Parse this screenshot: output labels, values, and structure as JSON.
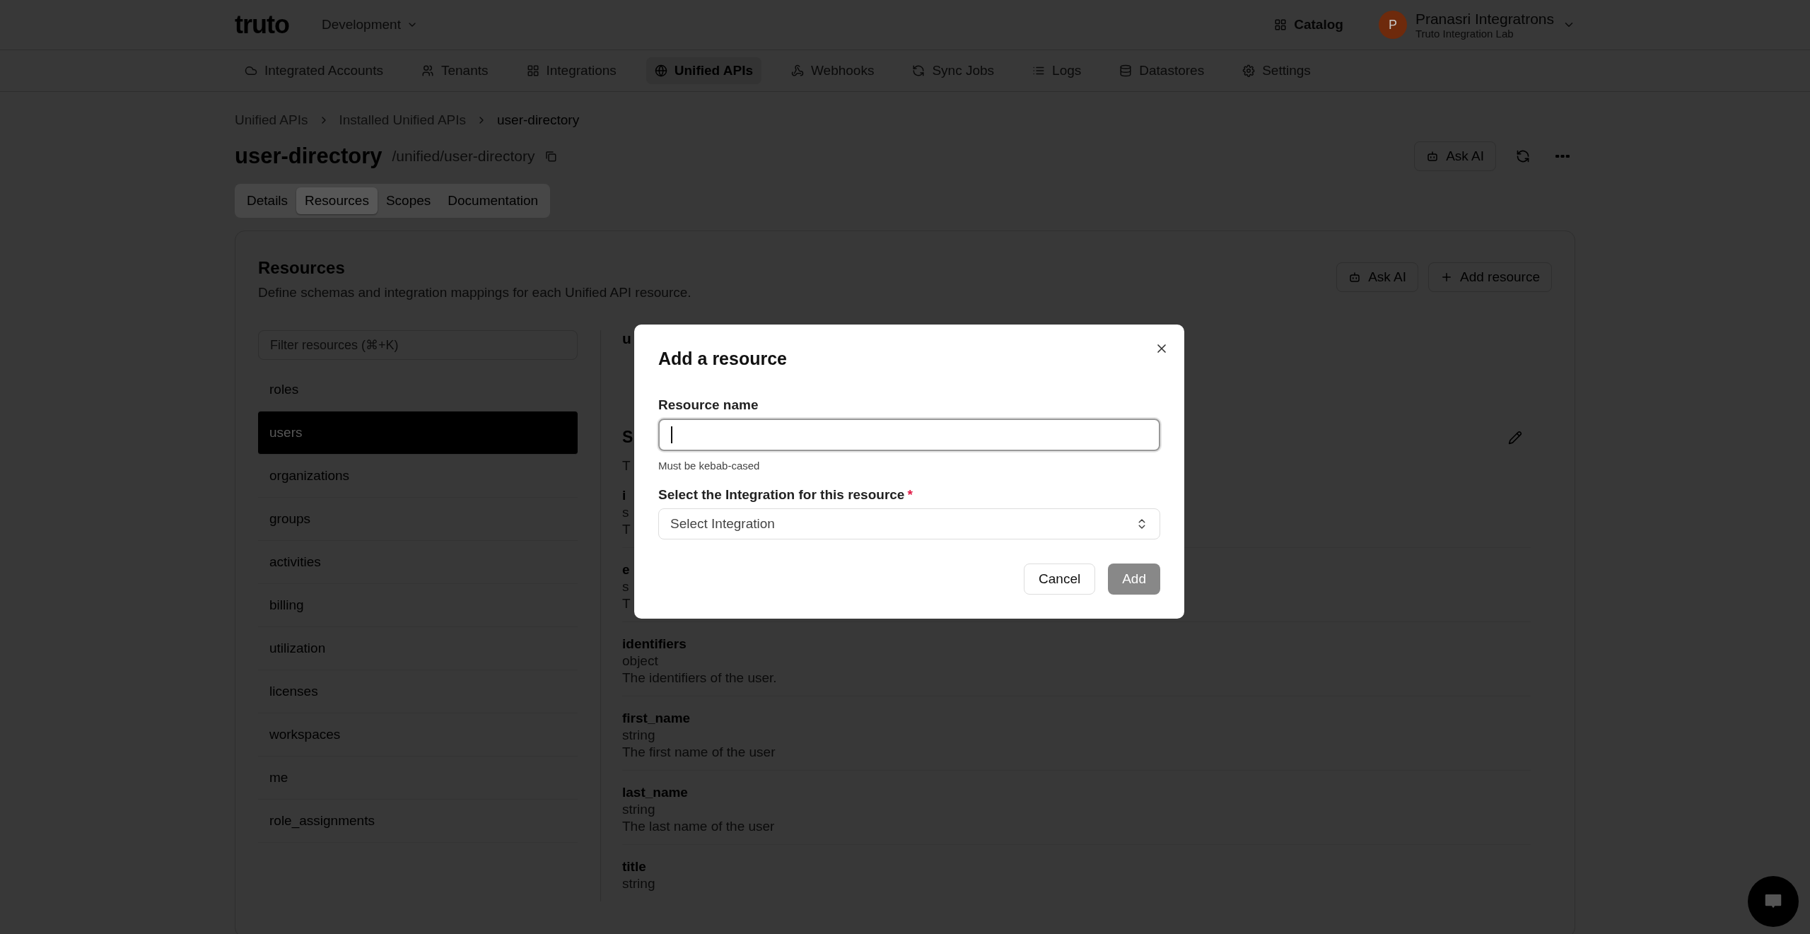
{
  "top_bar": {
    "logo": "truto",
    "environment": "Development",
    "catalog": "Catalog",
    "user": {
      "initial": "P",
      "name": "Pranasri Integratrons",
      "org": "Truto Integration Lab"
    }
  },
  "nav": [
    {
      "label": "Integrated Accounts",
      "selected": false
    },
    {
      "label": "Tenants",
      "selected": false
    },
    {
      "label": "Integrations",
      "selected": false
    },
    {
      "label": "Unified APIs",
      "selected": true
    },
    {
      "label": "Webhooks",
      "selected": false
    },
    {
      "label": "Sync Jobs",
      "selected": false
    },
    {
      "label": "Logs",
      "selected": false
    },
    {
      "label": "Datastores",
      "selected": false
    },
    {
      "label": "Settings",
      "selected": false
    }
  ],
  "breadcrumb": [
    "Unified APIs",
    "Installed Unified APIs",
    "user-directory"
  ],
  "page": {
    "title": "user-directory",
    "path": "/unified/user-directory",
    "ask_ai": "Ask AI"
  },
  "tabs": [
    {
      "label": "Details",
      "selected": false
    },
    {
      "label": "Resources",
      "selected": true
    },
    {
      "label": "Scopes",
      "selected": false
    },
    {
      "label": "Documentation",
      "selected": false
    }
  ],
  "resources": {
    "title": "Resources",
    "description": "Define schemas and integration mappings for each Unified API resource.",
    "ask_ai": "Ask AI",
    "add_button": "Add resource",
    "filter_placeholder": "Filter resources (⌘+K)",
    "items": [
      {
        "label": "roles",
        "selected": false
      },
      {
        "label": "users",
        "selected": true
      },
      {
        "label": "organizations",
        "selected": false
      },
      {
        "label": "groups",
        "selected": false
      },
      {
        "label": "activities",
        "selected": false
      },
      {
        "label": "billing",
        "selected": false
      },
      {
        "label": "utilization",
        "selected": false
      },
      {
        "label": "licenses",
        "selected": false
      },
      {
        "label": "workspaces",
        "selected": false
      },
      {
        "label": "me",
        "selected": false
      },
      {
        "label": "role_assignments",
        "selected": false
      }
    ],
    "detail": {
      "title": "u",
      "schema_title": "S",
      "schema_description": "T",
      "fields": [
        {
          "name": "i",
          "type": "s",
          "description": "T"
        },
        {
          "name": "e",
          "type": "s",
          "description": "T"
        },
        {
          "name": "identifiers",
          "type": "object",
          "description": "The identifiers of the user."
        },
        {
          "name": "first_name",
          "type": "string",
          "description": "The first name of the user"
        },
        {
          "name": "last_name",
          "type": "string",
          "description": "The last name of the user"
        },
        {
          "name": "title",
          "type": "string"
        }
      ]
    }
  },
  "dialog": {
    "title": "Add a resource",
    "name_label": "Resource name",
    "name_focused": true,
    "name_hint": "Must be kebab-cased",
    "integration_label": "Select the Integration for this resource",
    "required_mark": "*",
    "integration_placeholder": "Select Integration",
    "cancel": "Cancel",
    "submit": {
      "label": "Add",
      "disabled": true
    }
  }
}
